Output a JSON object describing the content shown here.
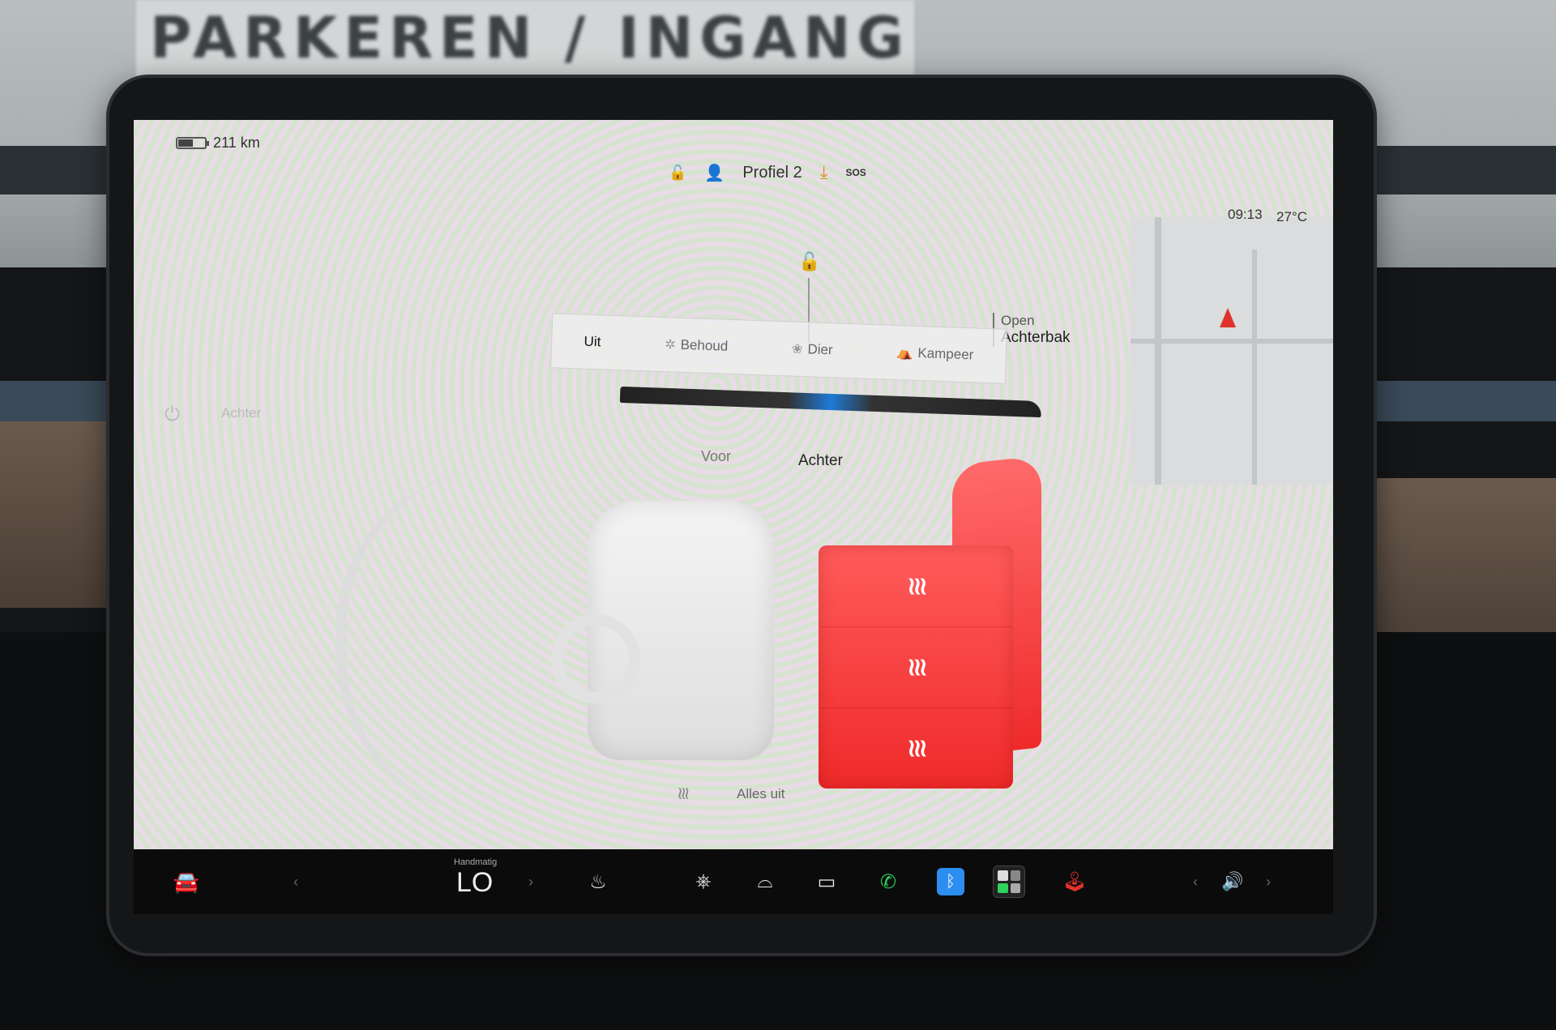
{
  "background": {
    "sign_text": "PARKEREN / INGANG"
  },
  "status": {
    "range": "211 km",
    "profile": "Profiel 2",
    "sos": "SOS",
    "time": "09:13",
    "temperature": "27°C"
  },
  "trunk": {
    "status_small": "Open",
    "status_big": "Achterbak"
  },
  "climate_modes": [
    {
      "label": "Uit",
      "icon": "",
      "active": true
    },
    {
      "label": "Behoud",
      "icon": "fan-icon",
      "active": false
    },
    {
      "label": "Dier",
      "icon": "paw-icon",
      "active": false
    },
    {
      "label": "Kampeer",
      "icon": "tent-icon",
      "active": false
    }
  ],
  "rear_control_ghost": "Achter",
  "zones": {
    "front": "Voor",
    "rear": "Achter"
  },
  "all_off": "Alles uit",
  "bottom_bar": {
    "temp_mode": "Handmatig",
    "temp_value": "LO"
  },
  "colors": {
    "seat_heat_active": "#f02a2a",
    "bluetooth": "#2b8ef0",
    "phone": "#2ed15a",
    "nav_arrow": "#e0322a"
  }
}
